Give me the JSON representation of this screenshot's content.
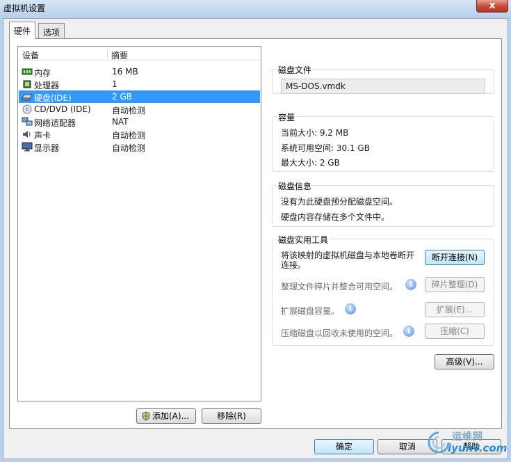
{
  "window": {
    "title": "虚拟机设置",
    "close_label": "x"
  },
  "tabs": [
    {
      "label": "硬件"
    },
    {
      "label": "选项"
    }
  ],
  "device_list": {
    "headers": {
      "device": "设备",
      "summary": "摘要"
    },
    "rows": [
      {
        "name": "内存",
        "summary": "16 MB",
        "icon": "memory-icon"
      },
      {
        "name": "处理器",
        "summary": "1",
        "icon": "processor-icon"
      },
      {
        "name": "硬盘(IDE)",
        "summary": "2 GB",
        "icon": "hard-disk-icon"
      },
      {
        "name": "CD/DVD (IDE)",
        "summary": "自动检测",
        "icon": "cd-dvd-icon"
      },
      {
        "name": "网络适配器",
        "summary": "NAT",
        "icon": "network-adapter-icon"
      },
      {
        "name": "声卡",
        "summary": "自动检测",
        "icon": "sound-card-icon"
      },
      {
        "name": "显示器",
        "summary": "自动检测",
        "icon": "display-icon"
      }
    ],
    "selected_index": 2
  },
  "list_buttons": {
    "add": "添加(A)...",
    "remove": "移除(R)"
  },
  "disk_file": {
    "legend": "磁盘文件",
    "value": "MS-DOS.vmdk"
  },
  "capacity": {
    "legend": "容量",
    "current_size": "当前大小: 9.2 MB",
    "free_space": "系统可用空间: 30.1 GB",
    "max_size": "最大大小: 2 GB"
  },
  "disk_info": {
    "legend": "磁盘信息",
    "line1": "没有为此硬盘预分配磁盘空间。",
    "line2": "硬盘内容存储在多个文件中。"
  },
  "utilities": {
    "legend": "磁盘实用工具",
    "map_text_line1": "将该映射的虚拟机磁盘与本地卷断开",
    "map_text_line2": "连接。",
    "disconnect_button": "断开连接(N)",
    "defrag_text": "整理文件碎片并整合可用空间。",
    "defrag_button": "碎片整理(D)",
    "expand_text": "扩展磁盘容量。",
    "expand_button": "扩展(E)...",
    "compact_text": "压缩磁盘以回收未使用的空间。",
    "compact_button": "压缩(C)"
  },
  "advanced_button": "高级(V)...",
  "dialog_buttons": {
    "ok": "确定",
    "cancel": "取消",
    "help": "帮助"
  },
  "watermark": {
    "line1": "运维网",
    "line2": "iyunv.com"
  },
  "colors": {
    "selection": "#3399ff",
    "window_frame": "#b9d1ea"
  }
}
